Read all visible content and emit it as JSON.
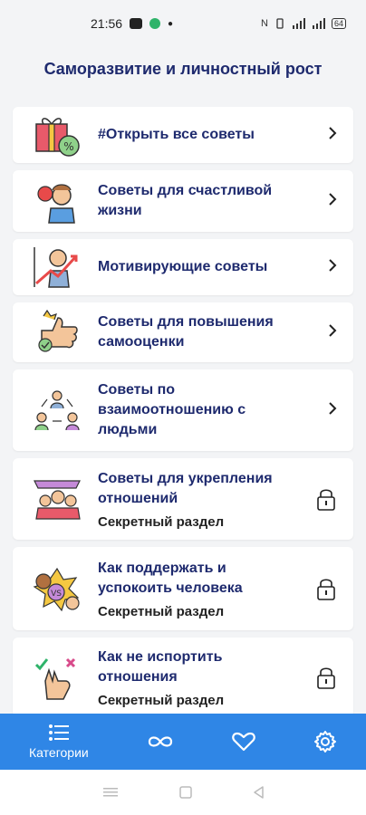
{
  "status": {
    "time": "21:56",
    "indicators": "N",
    "battery": "64"
  },
  "page": {
    "title": "Саморазвитие и личностный рост"
  },
  "categories": [
    {
      "label_lines": [
        "#Открыть все советы"
      ],
      "icon": "gift-percent-icon",
      "locked": false
    },
    {
      "label_lines": [
        "Советы для счастливой",
        "жизни"
      ],
      "icon": "happy-man-icon",
      "locked": false
    },
    {
      "label_lines": [
        "Мотивирующие советы"
      ],
      "icon": "growth-chart-icon",
      "locked": false
    },
    {
      "label_lines": [
        "Советы для повышения",
        "самооценки"
      ],
      "icon": "thumbs-up-icon",
      "locked": false
    },
    {
      "label_lines": [
        "Советы по",
        "взаимоотношению с",
        "людьми"
      ],
      "icon": "people-network-icon",
      "locked": false
    },
    {
      "label_lines": [
        "Советы для укрепления",
        "отношений"
      ],
      "icon": "family-icon",
      "locked": true,
      "secret": "Секретный раздел"
    },
    {
      "label_lines": [
        "Как поддержать и",
        "успокоить человека"
      ],
      "icon": "versus-icon",
      "locked": true,
      "secret": "Секретный раздел"
    },
    {
      "label_lines": [
        "Как не испортить",
        "отношения"
      ],
      "icon": "crossed-fingers-icon",
      "locked": true,
      "secret": "Секретный раздел"
    }
  ],
  "bottom_nav": {
    "categories_label": "Категории"
  },
  "colors": {
    "accent": "#2f86e6",
    "title": "#1e2a6e"
  }
}
